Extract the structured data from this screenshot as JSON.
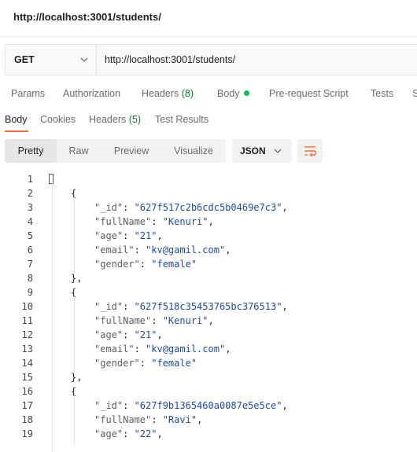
{
  "request": {
    "title": "http://localhost:3001/students/",
    "method": "GET",
    "url": "http://localhost:3001/students/"
  },
  "request_tabs": {
    "params": "Params",
    "authorization": "Authorization",
    "headers": "Headers",
    "headers_count": "(8)",
    "body": "Body",
    "prerequest": "Pre-request Script",
    "tests": "Tests",
    "settings_partial": "S"
  },
  "response_tabs": {
    "body": "Body",
    "cookies": "Cookies",
    "headers": "Headers",
    "headers_count": "(5)",
    "test_results": "Test Results"
  },
  "view_modes": {
    "pretty": "Pretty",
    "raw": "Raw",
    "preview": "Preview",
    "visualize": "Visualize"
  },
  "format": "JSON",
  "icons": {
    "method_dropdown": "chevron-down-icon",
    "format_dropdown": "chevron-down-icon",
    "wrap": "wrap-lines-icon",
    "body_dot": "status-dot-icon"
  },
  "colors": {
    "accent": "#ff6c37",
    "green_dot": "#0cbb52",
    "string": "#1d4ba8"
  },
  "code_lines": [
    {
      "n": "1",
      "type": "open_array"
    },
    {
      "n": "2",
      "type": "open_obj"
    },
    {
      "n": "3",
      "type": "kv",
      "key": "\"_id\"",
      "val": "\"627f517c2b6cdc5b0469e7c3\"",
      "comma": ","
    },
    {
      "n": "4",
      "type": "kv",
      "key": "\"fullName\"",
      "val": "\"Kenuri\"",
      "comma": ","
    },
    {
      "n": "5",
      "type": "kv",
      "key": "\"age\"",
      "val": "\"21\"",
      "comma": ","
    },
    {
      "n": "6",
      "type": "kv",
      "key": "\"email\"",
      "val": "\"kv@gamil.com\"",
      "comma": ","
    },
    {
      "n": "7",
      "type": "kv",
      "key": "\"gender\"",
      "val": "\"female\"",
      "comma": ""
    },
    {
      "n": "8",
      "type": "close_obj",
      "text": "},"
    },
    {
      "n": "9",
      "type": "open_obj"
    },
    {
      "n": "10",
      "type": "kv",
      "key": "\"_id\"",
      "val": "\"627f518c35453765bc376513\"",
      "comma": ","
    },
    {
      "n": "11",
      "type": "kv",
      "key": "\"fullName\"",
      "val": "\"Kenuri\"",
      "comma": ","
    },
    {
      "n": "12",
      "type": "kv",
      "key": "\"age\"",
      "val": "\"21\"",
      "comma": ","
    },
    {
      "n": "13",
      "type": "kv",
      "key": "\"email\"",
      "val": "\"kv@gamil.com\"",
      "comma": ","
    },
    {
      "n": "14",
      "type": "kv",
      "key": "\"gender\"",
      "val": "\"female\"",
      "comma": ""
    },
    {
      "n": "15",
      "type": "close_obj",
      "text": "},"
    },
    {
      "n": "16",
      "type": "open_obj"
    },
    {
      "n": "17",
      "type": "kv",
      "key": "\"_id\"",
      "val": "\"627f9b1365460a0087e5e5ce\"",
      "comma": ","
    },
    {
      "n": "18",
      "type": "kv",
      "key": "\"fullName\"",
      "val": "\"Ravi\"",
      "comma": ","
    },
    {
      "n": "19",
      "type": "kv",
      "key": "\"age\"",
      "val": "\"22\"",
      "comma": ","
    }
  ]
}
